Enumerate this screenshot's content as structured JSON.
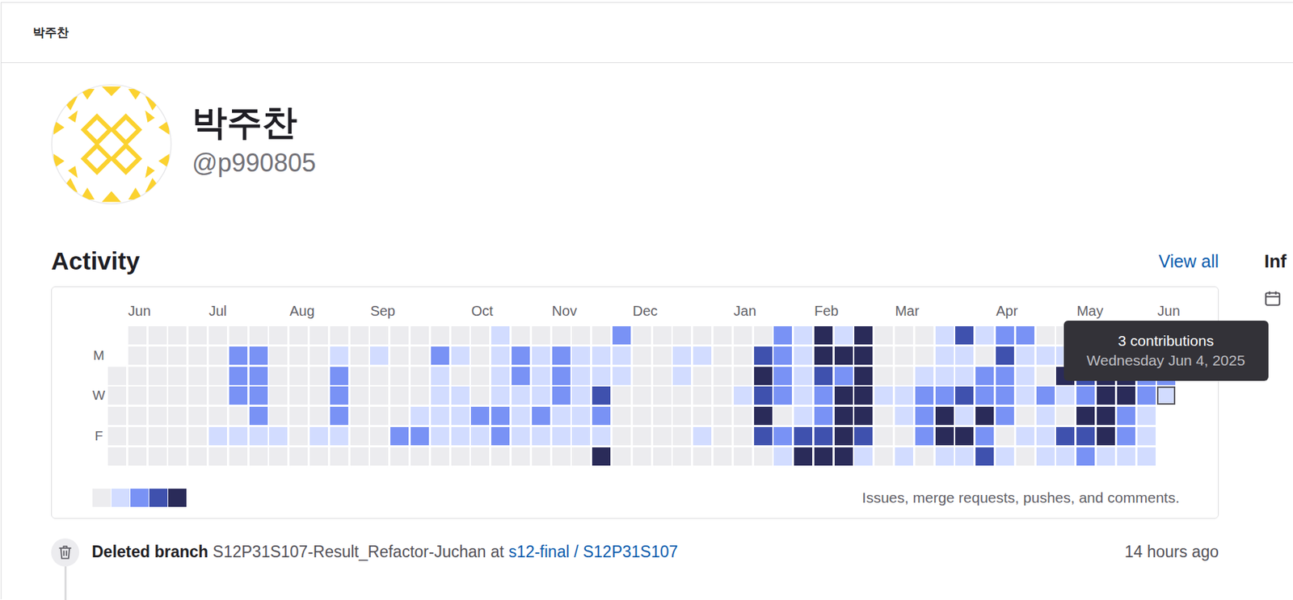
{
  "header": {
    "title": "박주찬"
  },
  "profile": {
    "name": "박주찬",
    "username": "@p990805"
  },
  "activity": {
    "title": "Activity",
    "view_all": "View all",
    "months": [
      {
        "label": "Jun",
        "week": 1
      },
      {
        "label": "Jul",
        "week": 5
      },
      {
        "label": "Aug",
        "week": 9
      },
      {
        "label": "Sep",
        "week": 13
      },
      {
        "label": "Oct",
        "week": 18
      },
      {
        "label": "Nov",
        "week": 22
      },
      {
        "label": "Dec",
        "week": 26
      },
      {
        "label": "Jan",
        "week": 31
      },
      {
        "label": "Feb",
        "week": 35
      },
      {
        "label": "Mar",
        "week": 39
      },
      {
        "label": "Apr",
        "week": 44
      },
      {
        "label": "May",
        "week": 48
      },
      {
        "label": "Jun",
        "week": 52
      }
    ],
    "day_labels": [
      "",
      "M",
      "",
      "W",
      "",
      "F",
      ""
    ],
    "days": [
      [
        null,
        0,
        0,
        0,
        0,
        0,
        0,
        0,
        0,
        0,
        0,
        0,
        0,
        0,
        0,
        0,
        0,
        0,
        0,
        1,
        0,
        0,
        0,
        0,
        0,
        2,
        0,
        0,
        0,
        0,
        0,
        0,
        0,
        2,
        1,
        4,
        1,
        4,
        0,
        0,
        0,
        1,
        3,
        1,
        2,
        2,
        0,
        0,
        1,
        3,
        2,
        1,
        1
      ],
      [
        null,
        0,
        0,
        0,
        0,
        0,
        2,
        2,
        0,
        0,
        0,
        1,
        0,
        1,
        0,
        0,
        2,
        1,
        0,
        1,
        2,
        1,
        2,
        1,
        1,
        1,
        0,
        0,
        1,
        1,
        0,
        0,
        3,
        2,
        1,
        4,
        4,
        4,
        0,
        0,
        0,
        1,
        1,
        0,
        3,
        1,
        1,
        1,
        4,
        4,
        3,
        1,
        2
      ],
      [
        0,
        0,
        0,
        0,
        0,
        0,
        2,
        2,
        0,
        0,
        0,
        2,
        0,
        0,
        0,
        0,
        1,
        0,
        0,
        1,
        2,
        1,
        2,
        1,
        1,
        1,
        0,
        0,
        1,
        0,
        0,
        0,
        4,
        2,
        1,
        3,
        2,
        4,
        0,
        0,
        1,
        1,
        1,
        2,
        2,
        1,
        0,
        4,
        3,
        4,
        4,
        2,
        2
      ],
      [
        0,
        0,
        0,
        0,
        0,
        0,
        2,
        2,
        0,
        0,
        0,
        2,
        0,
        0,
        0,
        0,
        1,
        1,
        0,
        1,
        1,
        1,
        2,
        1,
        3,
        0,
        0,
        0,
        0,
        0,
        0,
        1,
        3,
        2,
        1,
        2,
        4,
        4,
        1,
        1,
        2,
        2,
        3,
        2,
        2,
        1,
        2,
        1,
        2,
        4,
        4,
        2,
        1
      ],
      [
        0,
        0,
        0,
        0,
        0,
        0,
        0,
        2,
        0,
        0,
        0,
        2,
        0,
        0,
        0,
        1,
        1,
        1,
        2,
        2,
        1,
        2,
        1,
        1,
        2,
        0,
        0,
        0,
        0,
        0,
        0,
        0,
        4,
        0,
        1,
        2,
        4,
        4,
        0,
        1,
        2,
        4,
        1,
        4,
        2,
        0,
        1,
        0,
        4,
        4,
        2,
        1,
        null
      ],
      [
        0,
        0,
        0,
        0,
        0,
        1,
        1,
        1,
        1,
        0,
        1,
        1,
        0,
        0,
        2,
        2,
        1,
        1,
        1,
        2,
        1,
        1,
        1,
        1,
        1,
        0,
        0,
        0,
        0,
        1,
        0,
        0,
        3,
        2,
        3,
        3,
        4,
        3,
        0,
        0,
        2,
        4,
        4,
        2,
        0,
        1,
        1,
        3,
        3,
        4,
        2,
        1,
        null
      ],
      [
        0,
        0,
        0,
        0,
        0,
        0,
        0,
        0,
        0,
        0,
        0,
        0,
        0,
        0,
        0,
        0,
        0,
        0,
        0,
        0,
        0,
        0,
        0,
        0,
        4,
        0,
        0,
        0,
        0,
        0,
        0,
        0,
        0,
        1,
        4,
        4,
        4,
        1,
        0,
        1,
        0,
        1,
        1,
        3,
        1,
        0,
        1,
        1,
        2,
        1,
        1,
        1,
        null
      ]
    ],
    "legend": [
      0,
      1,
      2,
      3,
      4
    ],
    "caption": "Issues, merge requests, pushes, and comments.",
    "tooltip": {
      "title": "3 contributions",
      "date": "Wednesday Jun 4, 2025",
      "week": 52,
      "day": 3
    }
  },
  "info": {
    "title": "Inf"
  },
  "feed": [
    {
      "action": "Deleted branch",
      "branch": "S12P31S107-Result_Refactor-Juchan",
      "connector": "at",
      "project": "s12-final / S12P31S107",
      "time": "14 hours ago"
    }
  ]
}
